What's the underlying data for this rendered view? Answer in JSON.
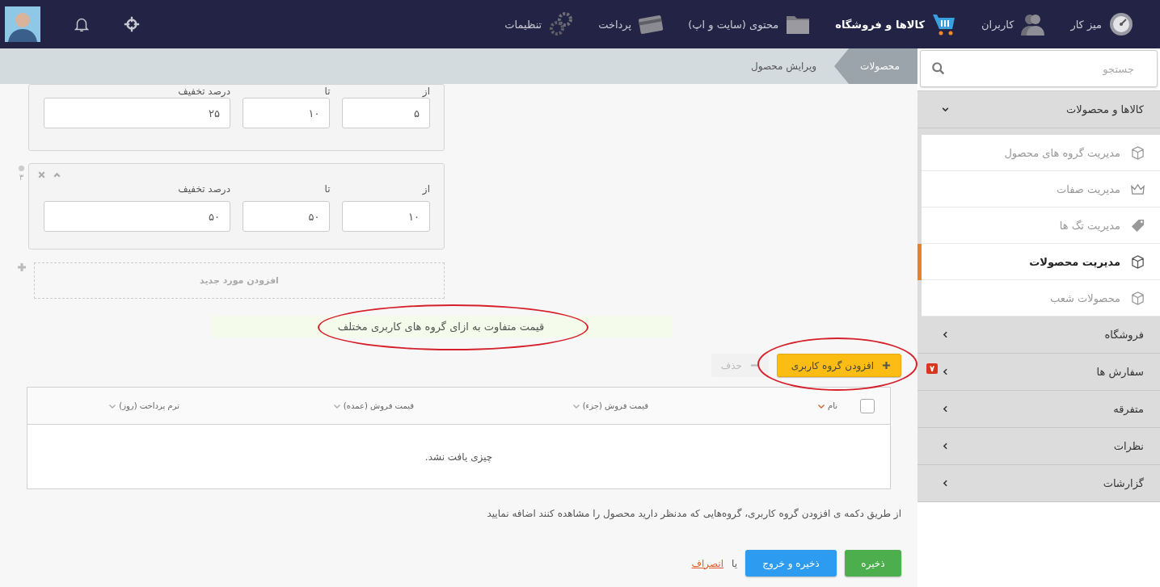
{
  "top_nav": {
    "items": [
      {
        "label": "میز کار",
        "selected": false
      },
      {
        "label": "کاربران",
        "selected": false
      },
      {
        "label": "کالاها و فروشگاه",
        "selected": true
      },
      {
        "label": "محتوی (سایت و اپ)",
        "selected": false
      },
      {
        "label": "پرداخت",
        "selected": false
      },
      {
        "label": "تنظیمات",
        "selected": false
      }
    ]
  },
  "breadcrumb": [
    {
      "label": "محصولات"
    },
    {
      "label": "ویرایش محصول"
    }
  ],
  "search": {
    "placeholder": "جستجو"
  },
  "sidebar": {
    "sections": [
      {
        "label": "کالاها و محصولات",
        "expanded": true,
        "children": [
          {
            "label": "مدیریت گروه های محصول",
            "selected": false
          },
          {
            "label": "مدیریت صفات",
            "selected": false
          },
          {
            "label": "مدیریت تگ ها",
            "selected": false
          },
          {
            "label": "مدیریت محصولات",
            "selected": true
          },
          {
            "label": "محصولات شعب",
            "selected": false
          }
        ]
      },
      {
        "label": "فروشگاه",
        "expanded": false
      },
      {
        "label": "سفارش ها",
        "expanded": false,
        "badge": "۷"
      },
      {
        "label": "متفرقه",
        "expanded": false
      },
      {
        "label": "نظرات",
        "expanded": false
      },
      {
        "label": "گزارشات",
        "expanded": false
      }
    ]
  },
  "discount_tiers": {
    "cards": [
      {
        "controls_visible": false,
        "fields": [
          {
            "label": "از",
            "value": "۵"
          },
          {
            "label": "تا",
            "value": "۱۰"
          },
          {
            "label": "درصد تخفیف",
            "value": "۲۵"
          }
        ]
      },
      {
        "controls_visible": true,
        "index": "۳",
        "fields": [
          {
            "label": "از",
            "value": "۱۰"
          },
          {
            "label": "تا",
            "value": "۵۰"
          },
          {
            "label": "درصد تخفیف",
            "value": "۵۰"
          }
        ]
      }
    ],
    "add_label": "افزودن مورد جدید"
  },
  "user_group_prices": {
    "title": "قیمت متفاوت به ازای گروه های کاربری مختلف",
    "title_circled": true,
    "add_button": {
      "label": "افزودن گروه کاربری",
      "circled": true
    },
    "delete_button": {
      "label": "حذف",
      "disabled": true
    },
    "table": {
      "select_all_checked": false,
      "columns": [
        {
          "label": "نام",
          "sorted": true
        },
        {
          "label": "قیمت فروش (جزء)",
          "sorted": false
        },
        {
          "label": "قیمت فروش (عمده)",
          "sorted": false
        },
        {
          "label": "ترم پرداخت (روز)",
          "sorted": false
        }
      ],
      "empty_message": "چیزی یافت نشد."
    },
    "hint": "از طریق دکمه ی افزودن گروه کاربری، گروه‌هایی که مدنظر دارید محصول را مشاهده کنند اضافه نمایید"
  },
  "actions": {
    "save": "ذخیره",
    "save_exit": "ذخیره و خروج",
    "or": "یا",
    "cancel": "انصراف"
  }
}
